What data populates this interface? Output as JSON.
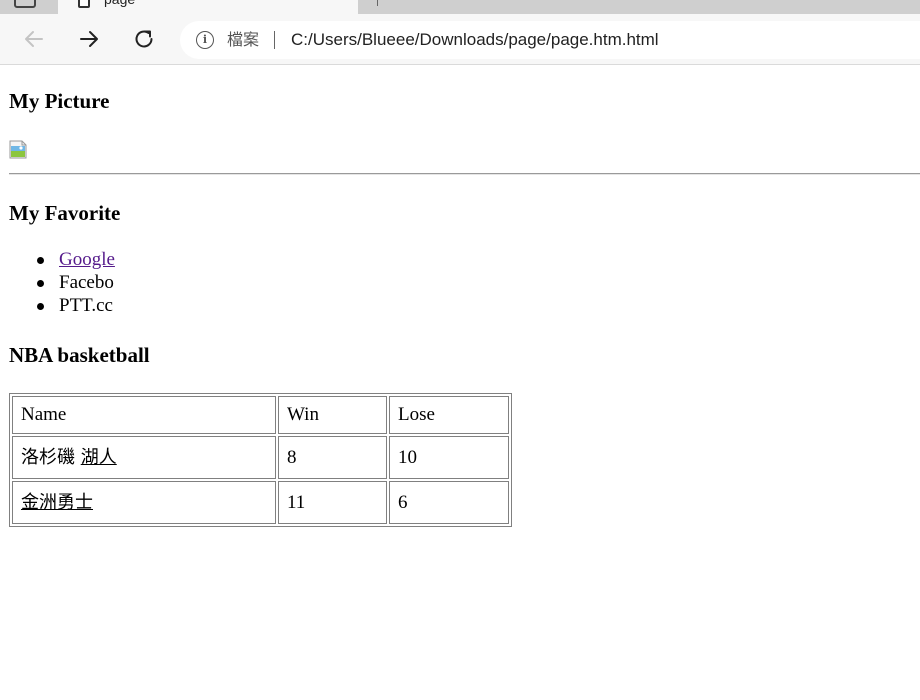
{
  "browser": {
    "tab": {
      "title": "page",
      "close_icon": "close-icon"
    },
    "omnibox": {
      "scheme_label": "檔案",
      "url": "C:/Users/Blueee/Downloads/page/page.htm.html"
    }
  },
  "page": {
    "picture_heading": "My Picture",
    "favorite_heading": "My Favorite",
    "favorites": [
      {
        "label": "Google"
      },
      {
        "label": "Facebo"
      },
      {
        "label": "PTT.cc"
      }
    ],
    "nba_heading": "NBA basketball",
    "table": {
      "headers": [
        "Name",
        "Win",
        "Lose"
      ],
      "rows": [
        {
          "name_prefix": "洛杉磯 ",
          "name_link": "湖人",
          "win": "8",
          "lose": "10"
        },
        {
          "name_link": "金洲勇士",
          "win": "11",
          "lose": "6"
        }
      ]
    }
  },
  "colors": {
    "visited_link": "#551a8b",
    "chrome_bg": "#f7f7f7",
    "tabstrip_bg": "#cfcfcf"
  }
}
